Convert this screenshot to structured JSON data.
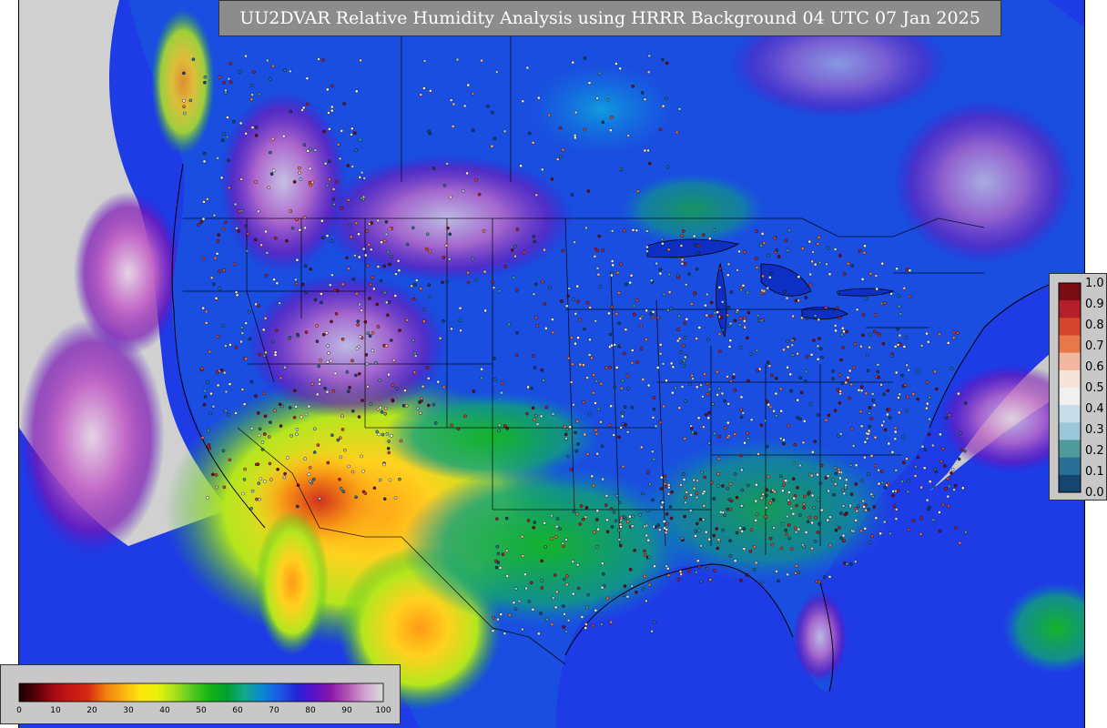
{
  "title": "UU2DVAR Relative Humidity Analysis using HRRR Background 04 UTC 07 Jan 2025",
  "ob_legend": {
    "labels": [
      "1.0",
      "0.9",
      "0.8",
      "0.7",
      "0.6",
      "0.5",
      "0.4",
      "0.3",
      "0.2",
      "0.1",
      "0.0"
    ],
    "colors": [
      "#7a0c14",
      "#b3202a",
      "#d6452e",
      "#e8774c",
      "#f2b7a1",
      "#f6e3dc",
      "#f0f0f0",
      "#c8dce9",
      "#9cc6da",
      "#4f9a9a",
      "#2a6f96",
      "#16456f"
    ]
  },
  "rh_colorbar": {
    "labels": [
      "0",
      "10",
      "20",
      "30",
      "40",
      "50",
      "60",
      "70",
      "80",
      "90",
      "100"
    ],
    "colors": [
      "#1a0000",
      "#5a0006",
      "#a30b12",
      "#c81614",
      "#d52a10",
      "#f07f0f",
      "#f9b30f",
      "#ffe60a",
      "#e6f20a",
      "#a6e01c",
      "#52c820",
      "#14b414",
      "#00a032",
      "#12a88c",
      "#0a88d2",
      "#1e5ae6",
      "#2424d8",
      "#5a10c8",
      "#8a1aa8",
      "#b45ab4",
      "#d2a6d2",
      "#dcdcdc"
    ]
  },
  "palette": {
    "ocean": "#1432d2",
    "land_humid": "#0a50e6",
    "land_dry": "#ffd21e",
    "outside": "#d0d0d0",
    "borders": "#000000"
  }
}
